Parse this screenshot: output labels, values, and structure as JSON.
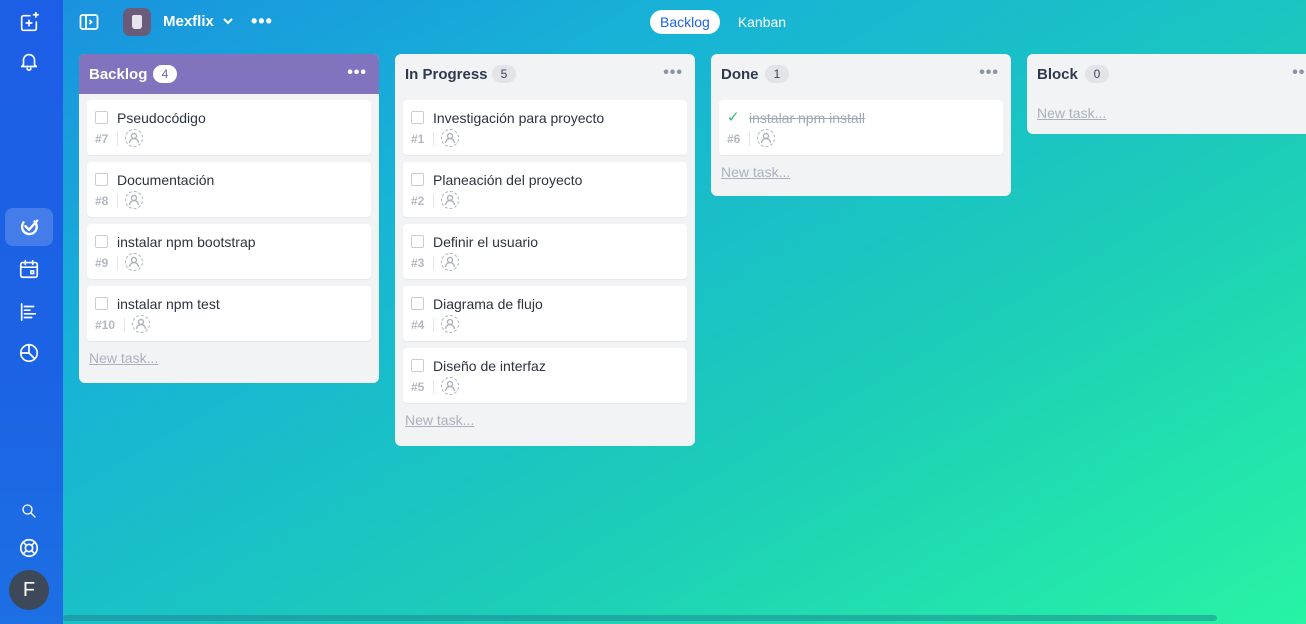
{
  "project": {
    "name": "Mexflix"
  },
  "view_tabs": [
    {
      "label": "Backlog",
      "active": true
    },
    {
      "label": "Kanban",
      "active": false
    }
  ],
  "user": {
    "initial": "F"
  },
  "columns": [
    {
      "title": "Backlog",
      "count": "4",
      "tasks": [
        {
          "title": "Pseudocódigo",
          "num": "#7"
        },
        {
          "title": "Documentación",
          "num": "#8"
        },
        {
          "title": "instalar npm bootstrap",
          "num": "#9"
        },
        {
          "title": "instalar npm test",
          "num": "#10"
        }
      ],
      "new_task": "New task..."
    },
    {
      "title": "In Progress",
      "count": "5",
      "tasks": [
        {
          "title": "Investigación para proyecto",
          "num": "#1"
        },
        {
          "title": "Planeación del proyecto",
          "num": "#2"
        },
        {
          "title": "Definir el usuario",
          "num": "#3"
        },
        {
          "title": "Diagrama de flujo",
          "num": "#4"
        },
        {
          "title": "Diseño de interfaz",
          "num": "#5"
        }
      ],
      "new_task": "New task..."
    },
    {
      "title": "Done",
      "count": "1",
      "tasks": [
        {
          "title": "instalar npm install",
          "num": "#6",
          "done": true
        }
      ],
      "new_task": "New task..."
    },
    {
      "title": "Block",
      "count": "0",
      "tasks": [],
      "new_task": "New task..."
    }
  ],
  "icons": {
    "rail": [
      "new-task-icon",
      "bell-icon",
      "tasks-logo-icon",
      "calendar-icon",
      "timeline-icon",
      "chart-icon",
      "search-icon",
      "help-icon"
    ]
  },
  "colors": {
    "backlog_header": "#8173bd",
    "rail": "#1d5ee6",
    "done_check": "#2dbd6e"
  }
}
